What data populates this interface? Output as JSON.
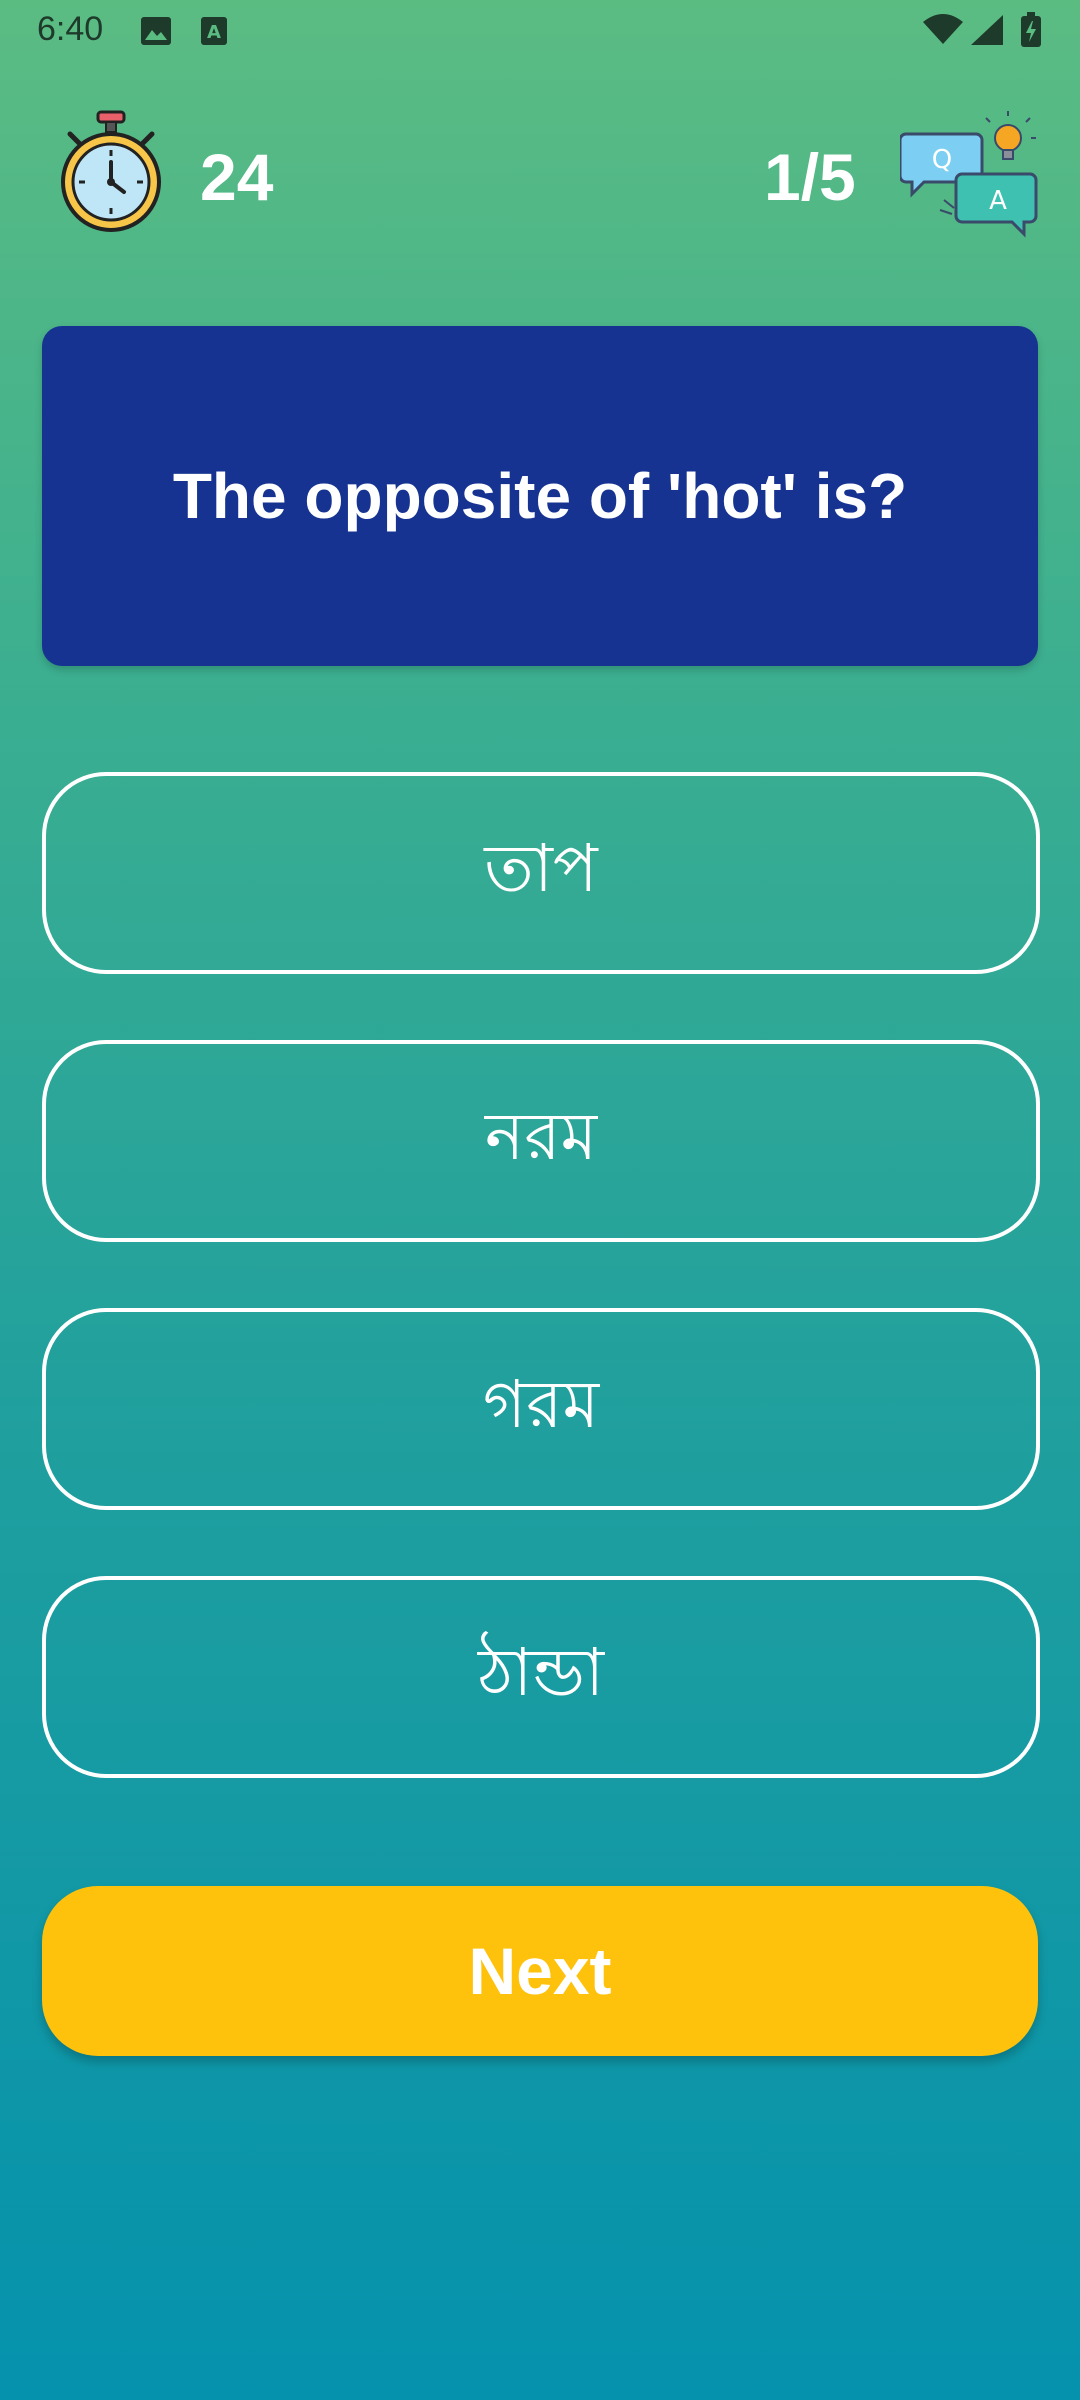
{
  "status_bar": {
    "time": "6:40",
    "icons": [
      "gallery-icon",
      "a-notification-icon",
      "wifi-icon",
      "signal-icon",
      "battery-icon"
    ]
  },
  "header": {
    "timer_icon": "stopwatch-icon",
    "timer_value": "24",
    "progress": "1/5",
    "qa_icon": "qa-bubbles-icon"
  },
  "question": {
    "text": "The opposite of 'hot' is?"
  },
  "options": [
    {
      "label": "তাপ"
    },
    {
      "label": "নরম"
    },
    {
      "label": "গরম"
    },
    {
      "label": "ঠান্ডা"
    }
  ],
  "next_button": {
    "label": "Next"
  },
  "colors": {
    "gradient_top": "#5bbc82",
    "gradient_bottom": "#0592ad",
    "question_card": "#163391",
    "next_button": "#fec20c"
  }
}
